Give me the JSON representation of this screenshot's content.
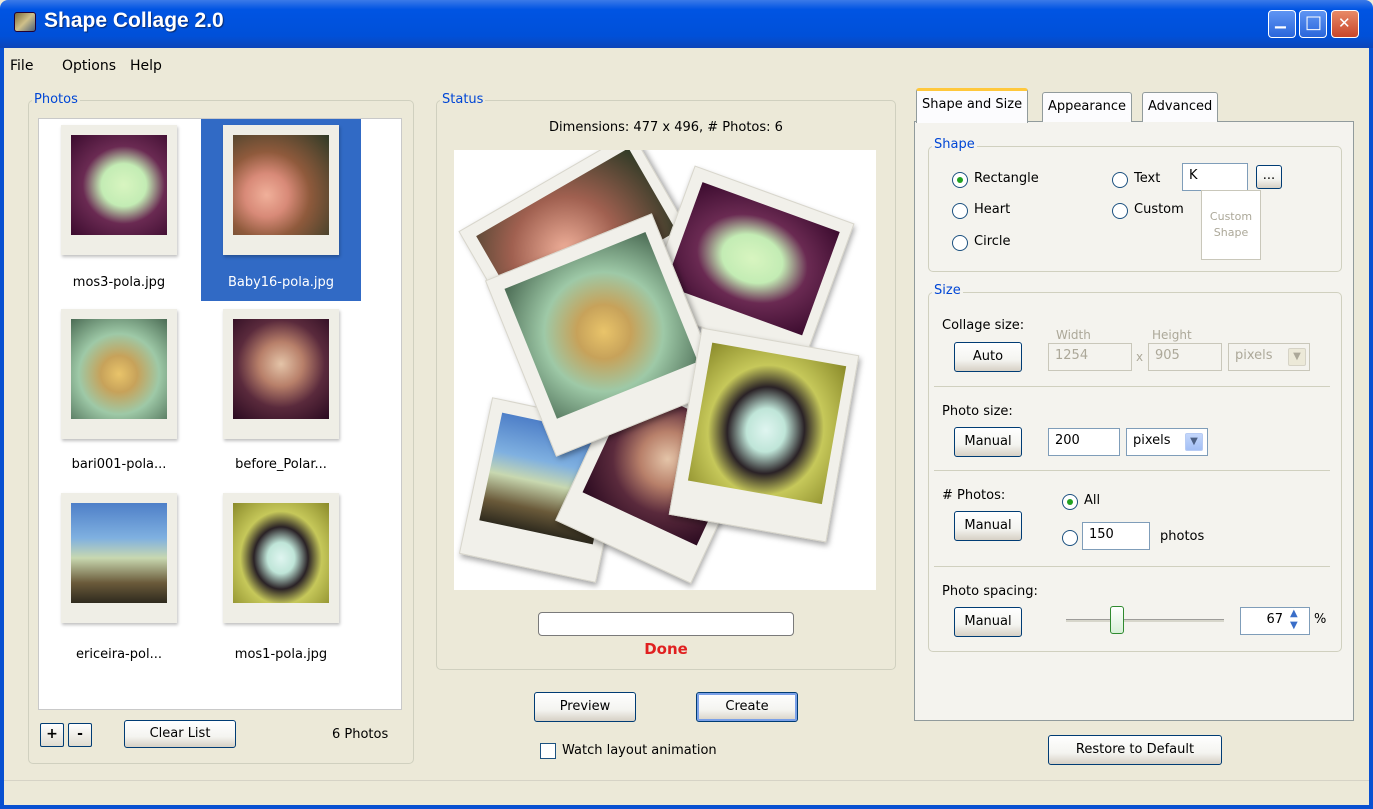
{
  "window": {
    "title": "Shape Collage 2.0",
    "minimize_glyph": "▁",
    "maximize_glyph": "□",
    "close_glyph": "✕"
  },
  "menu": {
    "file": "File",
    "options": "Options",
    "help": "Help"
  },
  "photos_panel": {
    "title": "Photos",
    "items": [
      {
        "label": "mos3-pola.jpg",
        "selected": false
      },
      {
        "label": "Baby16-pola.jpg",
        "selected": true
      },
      {
        "label": "bari001-pola...",
        "selected": false
      },
      {
        "label": "before_Polar...",
        "selected": false
      },
      {
        "label": "ericeira-pol...",
        "selected": false
      },
      {
        "label": "mos1-pola.jpg",
        "selected": false
      }
    ],
    "add_label": "+",
    "remove_label": "-",
    "clear_label": "Clear List",
    "count_label": "6 Photos"
  },
  "status_panel": {
    "title": "Status",
    "dimensions": "Dimensions: 477 x 496, # Photos: 6",
    "progress": 0,
    "status_text": "Done",
    "preview_label": "Preview",
    "create_label": "Create",
    "watch_label": "Watch layout animation",
    "watch_checked": false
  },
  "tabs": [
    {
      "label": "Shape and Size",
      "active": true
    },
    {
      "label": "Appearance",
      "active": false
    },
    {
      "label": "Advanced",
      "active": false
    }
  ],
  "shape": {
    "title": "Shape",
    "options": {
      "rectangle": "Rectangle",
      "heart": "Heart",
      "circle": "Circle",
      "text": "Text",
      "custom": "Custom"
    },
    "selected": "Rectangle",
    "text_value": "K",
    "browse_label": "...",
    "custom_shape_label_1": "Custom",
    "custom_shape_label_2": "Shape"
  },
  "size": {
    "title": "Size",
    "collage_size": {
      "label": "Collage size:",
      "button": "Auto",
      "width_hint": "Width",
      "height_hint": "Height",
      "width": "1254",
      "times": "x",
      "height": "905",
      "unit": "pixels"
    },
    "photo_size": {
      "label": "Photo size:",
      "button": "Manual",
      "value": "200",
      "unit": "pixels"
    },
    "num_photos": {
      "label": "# Photos:",
      "button": "Manual",
      "all_label": "All",
      "selected": "All",
      "count": "150",
      "suffix": "photos"
    },
    "photo_spacing": {
      "label": "Photo spacing:",
      "button": "Manual",
      "slider_value": 67,
      "value": "67",
      "suffix": "%"
    }
  },
  "restore_label": "Restore to Default",
  "colors": {
    "titlebar": "#0054e3",
    "selection": "#316ac5",
    "group_title": "#0046d5",
    "done": "#e02020",
    "tab_highlight": "#ffc83c"
  },
  "icons": {
    "app": "shape-collage-app-icon",
    "spinner": "spinner-arrows-icon",
    "dropdown": "chevron-down-icon"
  }
}
